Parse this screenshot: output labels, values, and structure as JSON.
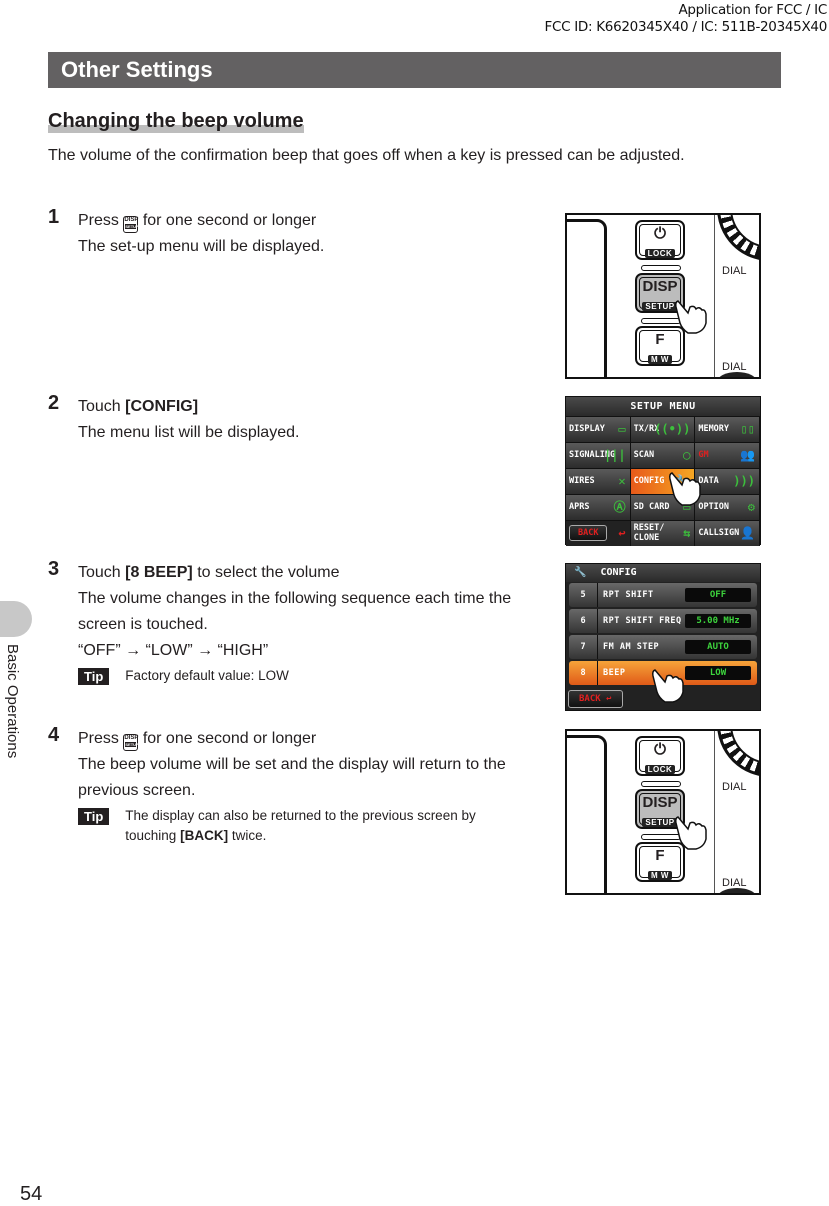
{
  "header": {
    "line1": "Application for FCC / IC",
    "line2": "FCC ID: K6620345X40 / IC: 511B-20345X40"
  },
  "section_title": "Other Settings",
  "subheading": "Changing the beep volume",
  "intro": "The volume of the confirmation beep that goes off when a key is pressed can be adjusted.",
  "steps": [
    {
      "num": "1",
      "line1_pre": "Press",
      "key_icon": "disp-setup-key",
      "line1_post": "for one second or longer",
      "body": "The set-up menu will be displayed."
    },
    {
      "num": "2",
      "line1_pre": "Touch",
      "line1_bold": "[CONFIG]",
      "body": "The menu list will be displayed."
    },
    {
      "num": "3",
      "line1_pre": "Touch",
      "line1_bold": "[8 BEEP]",
      "line1_post": "to select the volume",
      "body": "The volume changes in the following sequence each time the screen is touched.",
      "sequence": "“OFF” → “LOW” → “HIGH”",
      "tip_label": "Tip",
      "tip": "Factory default value: LOW"
    },
    {
      "num": "4",
      "line1_pre": "Press",
      "key_icon": "disp-setup-key",
      "line1_post": "for one second or longer",
      "body": "The beep volume will be set and the display will return to the previous screen.",
      "tip_label": "Tip",
      "tip_pre": "The display can also be returned to the previous screen by touching",
      "tip_bold": "[BACK]",
      "tip_post": "twice."
    }
  ],
  "radio_panel": {
    "lock_top": "⏻",
    "lock_label": "LOCK",
    "disp_top": "DISP",
    "disp_label": "SETUP",
    "f_top": "F",
    "f_label": "M W",
    "dial_label": "DIAL",
    "key_small_top": "DISP",
    "key_small_bottom": "SETUP"
  },
  "setup_menu": {
    "title": "SETUP MENU",
    "items": [
      {
        "label": "DISPLAY",
        "icon": "▭"
      },
      {
        "label": "TX/RX",
        "icon": "((•))"
      },
      {
        "label": "MEMORY",
        "icon": "▯▯"
      },
      {
        "label": "SIGNALING",
        "icon": "|||"
      },
      {
        "label": "SCAN",
        "icon": "◯"
      },
      {
        "label": "GM",
        "icon": "👥"
      },
      {
        "label": "WIRES",
        "icon": "✕"
      },
      {
        "label": "CONFIG",
        "icon": "🔧"
      },
      {
        "label": "DATA",
        "icon": ")))"
      },
      {
        "label": "APRS",
        "icon": "Ⓐ"
      },
      {
        "label": "SD CARD",
        "icon": "▭"
      },
      {
        "label": "OPTION",
        "icon": "⚙"
      },
      {
        "label": "BACK",
        "icon": "↩"
      },
      {
        "label": "RESET/",
        "label2": "CLONE",
        "icon": "⇆"
      },
      {
        "label": "CALLSIGN",
        "icon": "👤"
      }
    ],
    "active": "CONFIG"
  },
  "config_menu": {
    "title": "CONFIG",
    "rows": [
      {
        "num": "5",
        "name": "RPT SHIFT",
        "value": "OFF"
      },
      {
        "num": "6",
        "name": "RPT SHIFT FREQ",
        "value": "5.00 MHz"
      },
      {
        "num": "7",
        "name": "FM AM STEP",
        "value": "AUTO"
      },
      {
        "num": "8",
        "name": "BEEP",
        "value": "LOW"
      }
    ],
    "back_label": "BACK"
  },
  "side_tab": "Basic Operations",
  "page_number": "54"
}
